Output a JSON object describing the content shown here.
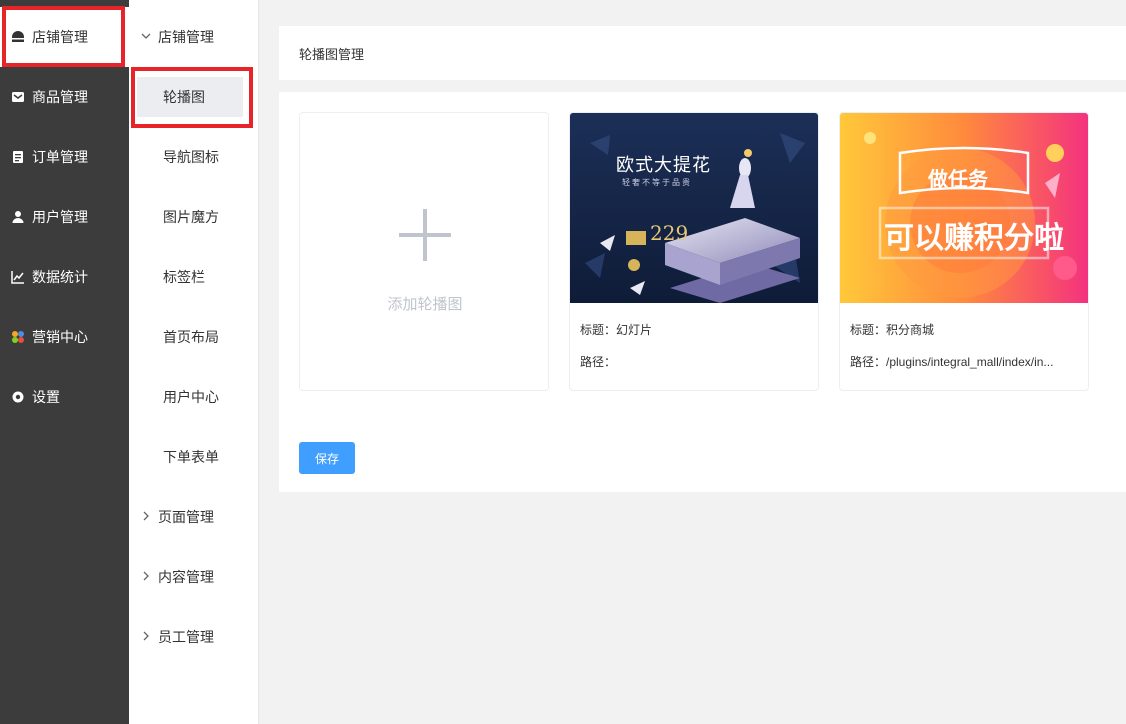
{
  "sidebar_primary": {
    "items": [
      {
        "label": "店铺管理",
        "icon": "store-icon",
        "active": true
      },
      {
        "label": "商品管理",
        "icon": "product-icon"
      },
      {
        "label": "订单管理",
        "icon": "order-icon"
      },
      {
        "label": "用户管理",
        "icon": "user-icon"
      },
      {
        "label": "数据统计",
        "icon": "chart-icon"
      },
      {
        "label": "营销中心",
        "icon": "marketing-icon"
      },
      {
        "label": "设置",
        "icon": "settings-icon"
      }
    ]
  },
  "sidebar_secondary": {
    "group_store": "店铺管理",
    "items": [
      "轮播图",
      "导航图标",
      "图片魔方",
      "标签栏",
      "首页布局",
      "用户中心",
      "下单表单"
    ],
    "group_pages": "页面管理",
    "group_content": "内容管理",
    "group_staff": "员工管理"
  },
  "main": {
    "header_title": "轮播图管理",
    "add_label": "添加轮播图",
    "banners": [
      {
        "title_line": "标题：幻灯片",
        "path_line": "路径：",
        "image_text_main": "欧式大提花",
        "image_text_sub": "轻奢不等于品贵",
        "image_price": "229"
      },
      {
        "title_line": "标题：积分商城",
        "path_line": "路径：/plugins/integral_mall/index/in...",
        "image_text_main": "做任务",
        "image_text_sub": "可以赚积分啦"
      }
    ],
    "save_label": "保存"
  },
  "colors": {
    "sidebar_bg": "#3c3c3c",
    "highlight": "#e5252a",
    "primary_button": "#409eff",
    "page_bg": "#f2f2f2"
  }
}
